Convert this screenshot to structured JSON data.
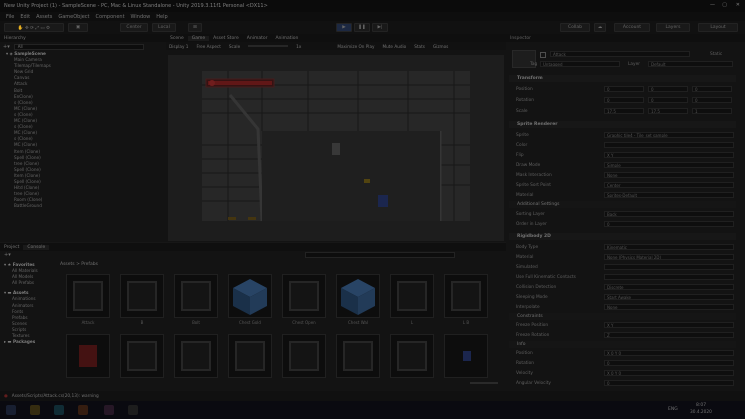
{
  "window_title": "New Unity Project (1) - SampleScene - PC, Mac & Linux Standalone - Unity 2019.3.11f1 Personal <DX11>",
  "menu": [
    "File",
    "Edit",
    "Assets",
    "GameObject",
    "Component",
    "Window",
    "Help"
  ],
  "toolbar": {
    "pivot": "Center",
    "space": "Local",
    "collab": "Collab",
    "account": "Account",
    "layers": "Layers",
    "layout": "Layout"
  },
  "hierarchy": {
    "tab": "Hierarchy",
    "search": "All",
    "scene": "SampleScene",
    "items": [
      "Main Camera",
      "Tilemap/Tilemaps",
      "New Grid",
      "Canvas",
      "Attack",
      "Bolt",
      "EnClone)",
      "s (Clone)",
      "MC (Clone)",
      "s (Clone)",
      "MC (Clone)",
      "s (Clone)",
      "MC (Clone)",
      "s (Clone)",
      "MC (Clone)",
      "Item (Clone)",
      "Spell (Clone)",
      "tree (Clone)",
      "Spell (Clone)",
      "Item (Clone)",
      "Spell (Clone)",
      "Hitd (Clone)",
      "tree (Clone)",
      "Room (Clone)",
      "BattleGround"
    ]
  },
  "scene_tabs": [
    "Scene",
    "Game",
    "Asset Store",
    "Animator",
    "Animation"
  ],
  "game_bar": {
    "display": "Display 1",
    "aspect": "Free Aspect",
    "scale_label": "Scale",
    "scale_value": "1x",
    "maximize": "Maximize On Play",
    "mute": "Mute Audio",
    "stats": "Stats",
    "gizmos": "Gizmos"
  },
  "project": {
    "tabs": [
      "Project",
      "Console"
    ],
    "breadcrumb": "Assets > Prefabs",
    "favorites_label": "Favorites",
    "favorites": [
      "All Materials",
      "All Models",
      "All Prefabs"
    ],
    "assets_label": "Assets",
    "folders": [
      "Animations",
      "Animators",
      "Fonts",
      "Prefabs",
      "Scenes",
      "Scripts",
      "Textures"
    ],
    "packages_label": "Packages",
    "row1": [
      "Attack",
      "B",
      "Bolt",
      "Chest Gold",
      "Chest Open",
      "Chest Wal",
      "L",
      "L B"
    ],
    "row2": [
      "",
      "",
      "",
      "",
      "",
      "",
      "",
      ""
    ]
  },
  "inspector": {
    "tab": "Inspector",
    "name": "Attack",
    "static": "Static",
    "tag_label": "Tag",
    "tag": "Untagged",
    "layer_label": "Layer",
    "layer": "Default",
    "transform": "Transform",
    "pos_label": "Position",
    "rot_label": "Rotation",
    "scale_label": "Scale",
    "position": [
      "0",
      "0",
      "0"
    ],
    "rotation": [
      "0",
      "0",
      "0"
    ],
    "scale": [
      "17.5",
      "17.5",
      "1"
    ],
    "sprite_renderer": "Sprite Renderer",
    "sr_fields": [
      [
        "Sprite",
        "Graphic tile4 - Tile_set sample"
      ],
      [
        "Color",
        ""
      ],
      [
        "Flip",
        "X  Y"
      ],
      [
        "Draw Mode",
        "Simple"
      ],
      [
        "Mask Interaction",
        "None"
      ],
      [
        "Sprite Sort Point",
        "Center"
      ],
      [
        "Material",
        "Sprites-Default"
      ]
    ],
    "additional": "Additional Settings",
    "add_fields": [
      [
        "Sorting Layer",
        "Back"
      ],
      [
        "Order in Layer",
        "0"
      ]
    ],
    "rigidbody": "Rigidbody 2D",
    "rb_fields": [
      [
        "Body Type",
        "Kinematic"
      ],
      [
        "Material",
        "None (Physics Material 2D)"
      ],
      [
        "Simulated",
        ""
      ],
      [
        "Use Full Kinematic Contacts",
        ""
      ],
      [
        "Collision Detection",
        "Discrete"
      ],
      [
        "Sleeping Mode",
        "Start Awake"
      ],
      [
        "Interpolate",
        "None"
      ]
    ],
    "constraints": "Constraints",
    "con_fields": [
      [
        "Freeze Position",
        "X  Y"
      ],
      [
        "Freeze Rotation",
        "Z"
      ]
    ],
    "info": "Info",
    "info_fields": [
      [
        "Position",
        "X 0   Y 0"
      ],
      [
        "Rotation",
        "0"
      ],
      [
        "Velocity",
        "X 0   Y 0"
      ],
      [
        "Angular Velocity",
        "0"
      ]
    ]
  },
  "status": "Assets/Scripts/Attack.cs(20,13): warning",
  "clock": {
    "time": "8:07",
    "date": "30.4.2020",
    "lang": "ENG"
  },
  "colors": {
    "health": "#8a1f1f",
    "selection": "#2a3a55",
    "play": "#3b5fa8"
  }
}
